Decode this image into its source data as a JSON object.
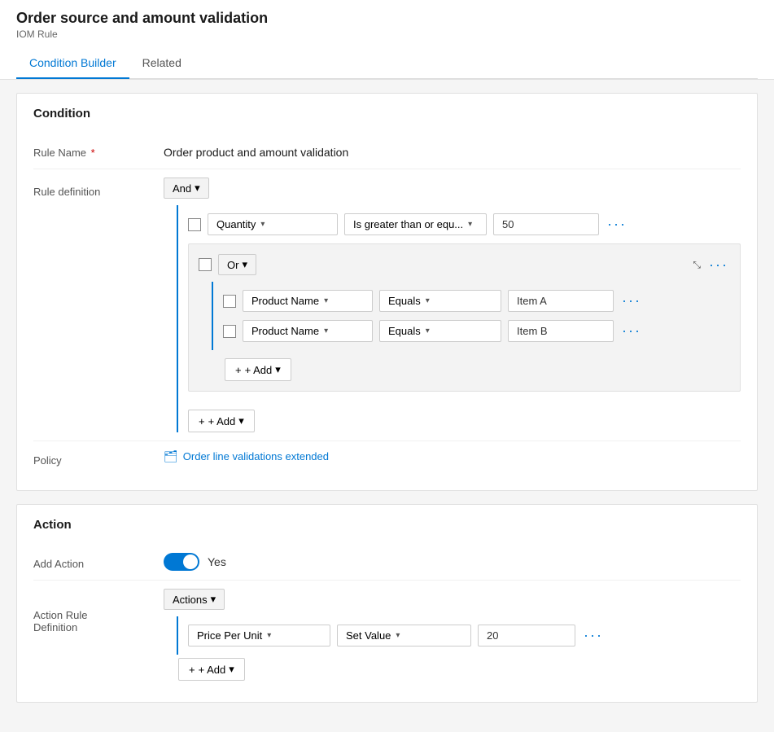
{
  "page": {
    "title": "Order source and amount validation",
    "subtitle": "IOM Rule"
  },
  "tabs": [
    {
      "id": "condition-builder",
      "label": "Condition Builder",
      "active": true
    },
    {
      "id": "related",
      "label": "Related",
      "active": false
    }
  ],
  "condition_section": {
    "title": "Condition",
    "rule_name_label": "Rule Name",
    "rule_name_value": "Order product and amount validation",
    "rule_definition_label": "Rule definition",
    "policy_label": "Policy",
    "policy_link_text": "Order line validations extended",
    "logic_operator": "And",
    "quantity_row": {
      "field": "Quantity",
      "operator": "Is greater than or equ...",
      "value": "50"
    },
    "or_group": {
      "operator": "Or",
      "rows": [
        {
          "field": "Product Name",
          "operator": "Equals",
          "value": "Item A"
        },
        {
          "field": "Product Name",
          "operator": "Equals",
          "value": "Item B"
        }
      ]
    },
    "add_button": "+ Add",
    "inner_add_button": "+ Add"
  },
  "action_section": {
    "title": "Action",
    "add_action_label": "Add Action",
    "add_action_value": "Yes",
    "toggle_on": true,
    "action_rule_label": "Action Rule\nDefinition",
    "action_operator": "Actions",
    "action_row": {
      "field": "Price Per Unit",
      "operator": "Set Value",
      "value": "20"
    },
    "add_button": "+ Add"
  },
  "icons": {
    "chevron_down": "▾",
    "plus": "+",
    "more": "···",
    "collapse": "⤡",
    "policy": "🗂"
  }
}
